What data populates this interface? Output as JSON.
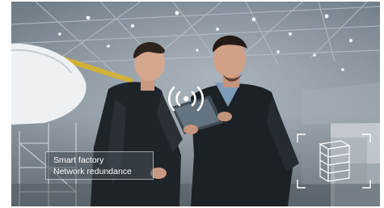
{
  "overlay": {
    "line1": "Smart factory",
    "line2": "Network redundance"
  },
  "icons": {
    "signal": "wireless-signal-icon",
    "server": "server-rack-icon"
  },
  "colors": {
    "overlay_text": "#ffffff",
    "overlay_border": "#ffffff",
    "hangar_steel": "#8a949c"
  }
}
